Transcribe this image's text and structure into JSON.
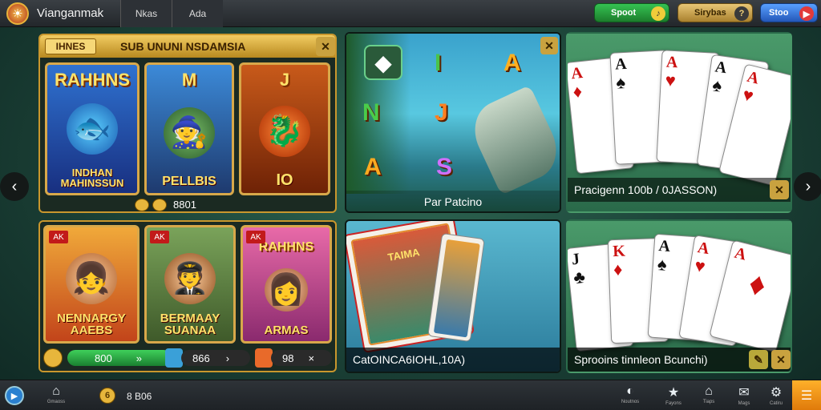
{
  "app": {
    "title": "Vianganmak",
    "logo_icon": "☀"
  },
  "tabs": [
    {
      "label": "Nkas"
    },
    {
      "label": "Ada"
    }
  ],
  "header_pills": [
    {
      "label": "Spoot",
      "icon": "♪",
      "color": "#27a33d"
    },
    {
      "label": "Sirybas",
      "icon": "?",
      "color": "#d4ae55"
    },
    {
      "label": "Stoo",
      "icon": "▶",
      "color": "#3b79d9"
    }
  ],
  "slots_panel": {
    "badge": "IHNES",
    "title": "SUB UNUNI NSDAMSIA",
    "games": [
      {
        "top": "RAHHNS",
        "icon": "🐟",
        "bottom": "INDHAN MAHINSSUN"
      },
      {
        "top": "M",
        "icon": "🧙",
        "bottom": "PELLBIS"
      },
      {
        "top": "J",
        "icon": "🐉",
        "bottom": "IO"
      }
    ],
    "footer_value": "8801"
  },
  "characters_panel": {
    "games": [
      {
        "tag": "AK",
        "icon": "👧",
        "bottom": "NENNARGY AAEBS"
      },
      {
        "tag": "AK",
        "icon": "🧑‍✈️",
        "bottom": "BERMAAY SUANAA"
      },
      {
        "tag": "AK",
        "icon": "👩",
        "bottom": "ARMAS",
        "top": "RAHHNS"
      }
    ],
    "stats": [
      {
        "value": "800",
        "mark": "»"
      },
      {
        "value": "866",
        "mark": "›"
      },
      {
        "value": "98",
        "mark": "×"
      }
    ]
  },
  "reel_panel": {
    "caption": "Par Patcino",
    "symbols": [
      "N",
      "J",
      "A",
      "S"
    ],
    "top_symbol": "A"
  },
  "cards_panel_top": {
    "caption": "Pracigenn 100b / 0JASSON)",
    "cards": [
      {
        "rank": "A",
        "suit": "♦",
        "red": true
      },
      {
        "rank": "A",
        "suit": "♠",
        "red": false
      },
      {
        "rank": "A",
        "suit": "♥",
        "red": true
      },
      {
        "rank": "A",
        "suit": "♠",
        "red": false
      },
      {
        "rank": "A",
        "suit": "♥",
        "red": true
      }
    ]
  },
  "tarot_panel": {
    "caption": "CatOINCA6IOHL,10A)",
    "card_label": "TAIMA"
  },
  "cards_panel_bottom": {
    "caption": "Sprooins tinnleon Bcunchi)",
    "cards": [
      {
        "rank": "J",
        "suit": "♣",
        "red": false
      },
      {
        "rank": "K",
        "suit": "♦",
        "red": true
      },
      {
        "rank": "A",
        "suit": "♠",
        "red": false
      },
      {
        "rank": "A",
        "suit": "♥",
        "red": true
      },
      {
        "rank": "A",
        "suit": "♦",
        "red": true
      }
    ]
  },
  "bottom": {
    "play_icon": "▶",
    "home_label": "Gmaoss",
    "coin_icon": "6",
    "balance": "8 B06",
    "nav": [
      {
        "icon": "◐",
        "label": "Noutnos"
      },
      {
        "icon": "★",
        "label": "Fayons"
      },
      {
        "icon": "⌂",
        "label": "Tiaps"
      },
      {
        "icon": "✉",
        "label": "Mags"
      },
      {
        "icon": "⚙",
        "label": "Catiru"
      }
    ]
  },
  "colors": {
    "gold": "#c9972d",
    "accent": "#f0a21a"
  }
}
